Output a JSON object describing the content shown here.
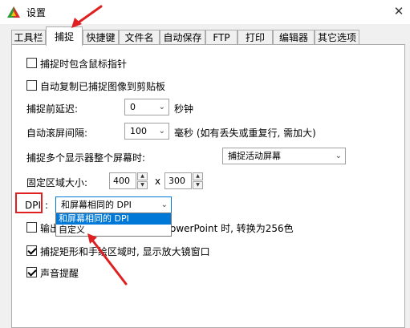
{
  "window": {
    "title": "设置",
    "close_label": "✕"
  },
  "tabs": [
    {
      "label": "工具栏"
    },
    {
      "label": "捕捉"
    },
    {
      "label": "快捷键"
    },
    {
      "label": "文件名"
    },
    {
      "label": "自动保存"
    },
    {
      "label": "FTP"
    },
    {
      "label": "打印"
    },
    {
      "label": "编辑器"
    },
    {
      "label": "其它选项"
    }
  ],
  "active_tab": "捕捉",
  "capture": {
    "include_cursor": {
      "label": "捕捉时包含鼠标指针",
      "checked": false
    },
    "auto_copy": {
      "label": "自动复制已捕捉图像到剪贴板",
      "checked": false
    },
    "delay": {
      "label": "捕捉前延迟:",
      "value": "0",
      "unit": "秒钟"
    },
    "scroll_interval": {
      "label": "自动滚屏间隔:",
      "value": "100",
      "unit": "毫秒 (如有丢失或重复行, 需加大)"
    },
    "multi_monitor": {
      "label": "捕捉多个显示器整个屏幕时:",
      "value": "捕捉活动屏幕"
    },
    "fixed_region": {
      "label": "固定区域大小:",
      "width": "400",
      "separator": "x",
      "height": "300"
    },
    "dpi": {
      "label": "DPI",
      "colon": ":",
      "value": "和屏幕相同的 DPI",
      "options": [
        "和屏幕相同的 DPI",
        "自定义"
      ],
      "highlighted_option": 0
    },
    "output_row": {
      "label_left": "输出",
      "label_right": "owerPoint 时, 转换为256色",
      "checked": false
    },
    "magnifier": {
      "label": "捕捉矩形和手绘区域时, 显示放大镜窗口",
      "checked": true
    },
    "sound": {
      "label": "声音提醒",
      "checked": true
    }
  },
  "icons": {
    "app": "app-logo-icon",
    "close": "close-icon",
    "dropdown": "chevron-down-icon",
    "spin_up": "spin-up-icon",
    "spin_down": "spin-down-icon"
  },
  "colors": {
    "annotation_red": "#e02020",
    "selection_blue": "#0078d7"
  }
}
